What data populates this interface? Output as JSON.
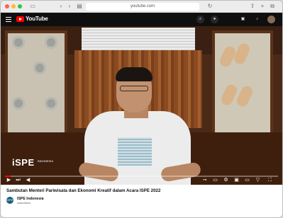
{
  "browser": {
    "address": "youtube.com"
  },
  "header": {
    "logo_text": "YouTube"
  },
  "video": {
    "watermark": "iSPE",
    "watermark_sub": "INDONESIA",
    "progress_fraction": 0.02
  },
  "details": {
    "title": "Sambutan Menteri Pariwisata dan Ekonomi Kreatif dalam Acara ISPE 2022",
    "channel_name": "ISPE Indonesia",
    "channel_subs": "subscribers"
  }
}
